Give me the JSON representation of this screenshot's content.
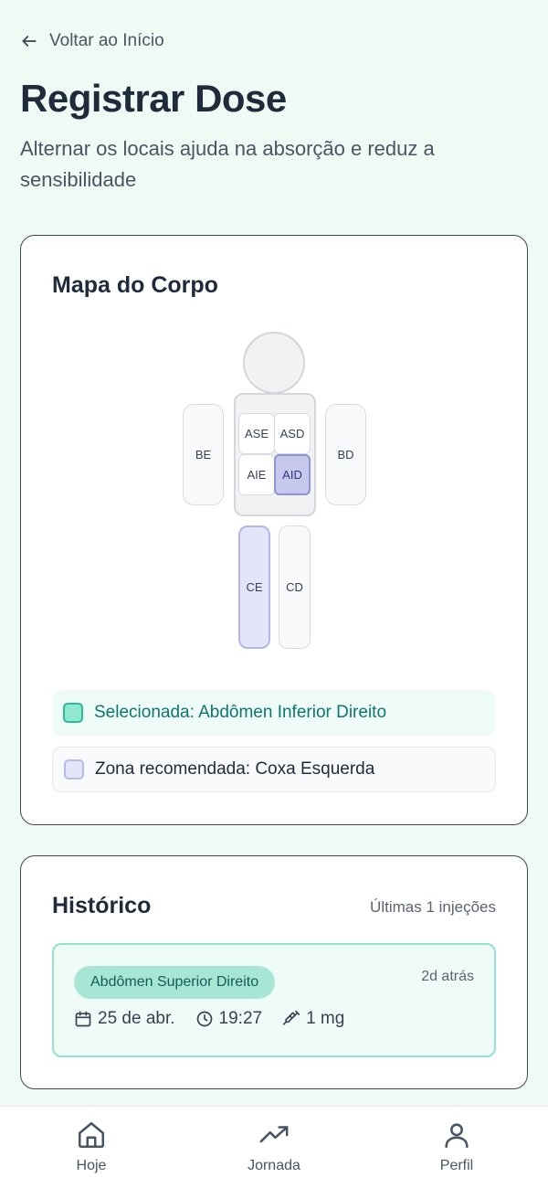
{
  "header": {
    "back_label": "Voltar ao Início",
    "title": "Registrar Dose",
    "subtitle": "Alternar os locais ajuda na absorção e reduz a sensibilidade"
  },
  "body_map": {
    "title": "Mapa do Corpo",
    "zones": {
      "be": "BE",
      "bd": "BD",
      "ase": "ASE",
      "asd": "ASD",
      "aie": "AIE",
      "aid": "AID",
      "ce": "CE",
      "cd": "CD"
    },
    "selected_zone": "AID",
    "recommended_zone": "CE",
    "legend": {
      "selected": "Selecionada: Abdômen Inferior Direito",
      "recommended": "Zona recomendada: Coxa Esquerda"
    }
  },
  "history": {
    "title": "Histórico",
    "count_label": "Últimas 1 injeções",
    "items": [
      {
        "site": "Abdômen Superior Direito",
        "time_ago": "2d atrás",
        "date": "25 de abr.",
        "time": "19:27",
        "dose": "1 mg"
      }
    ]
  },
  "nav": {
    "home": "Hoje",
    "journey": "Jornada",
    "profile": "Perfil"
  },
  "colors": {
    "background": "#eefaf3",
    "selected": "#8fe9cf",
    "recommended": "#e4e5f8",
    "accent_text": "#0f766e"
  }
}
